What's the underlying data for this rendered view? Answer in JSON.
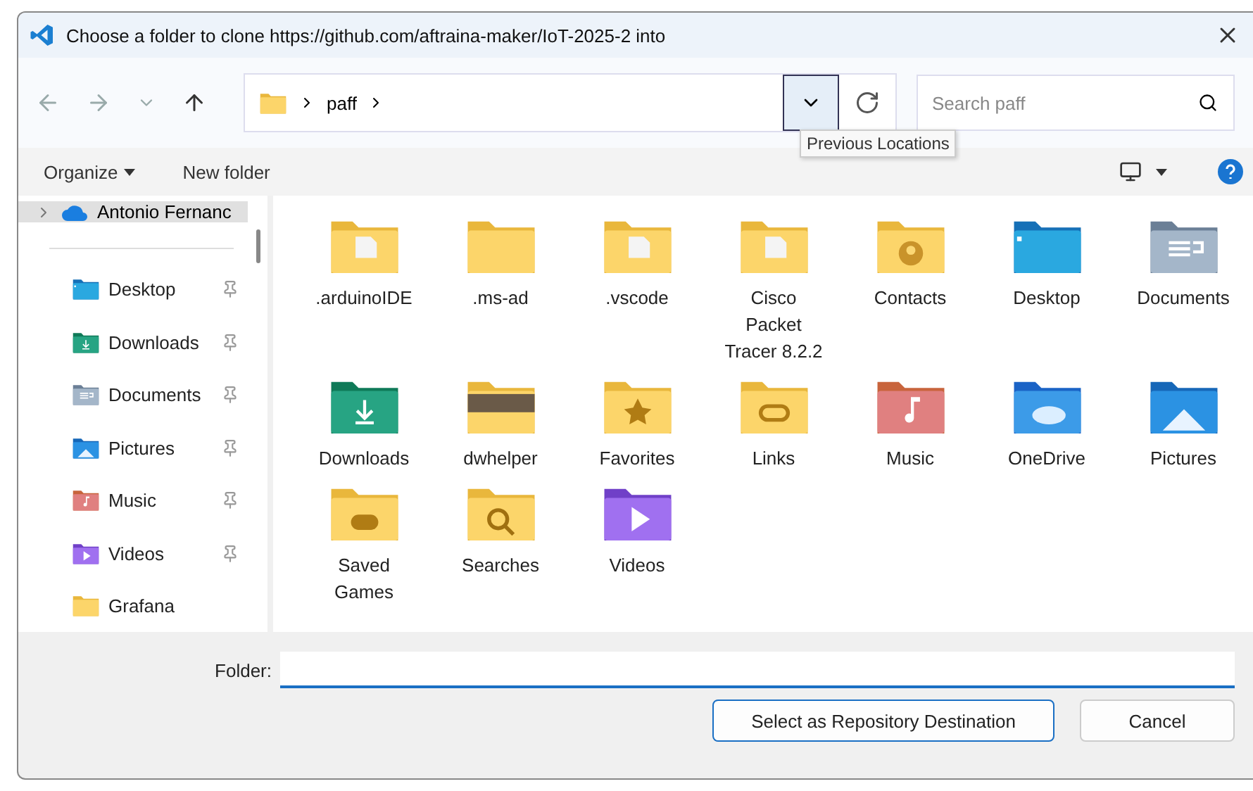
{
  "window": {
    "title": "Choose a folder to clone https://github.com/aftraina-maker/IoT-2025-2 into"
  },
  "address": {
    "segments": [
      "paff"
    ]
  },
  "recent_dropdown": {
    "tooltip": "Previous Locations"
  },
  "search": {
    "placeholder": "Search paff"
  },
  "commands": {
    "organize": "Organize",
    "new_folder": "New folder"
  },
  "sidebar": {
    "root": {
      "label": "Antonio Fernanc",
      "selected": true
    },
    "items": [
      {
        "label": "Desktop",
        "kind": "desktop",
        "pinned": true
      },
      {
        "label": "Downloads",
        "kind": "downloads",
        "pinned": true
      },
      {
        "label": "Documents",
        "kind": "documents",
        "pinned": true
      },
      {
        "label": "Pictures",
        "kind": "pictures",
        "pinned": true
      },
      {
        "label": "Music",
        "kind": "music",
        "pinned": true
      },
      {
        "label": "Videos",
        "kind": "videos",
        "pinned": true
      },
      {
        "label": "Grafana",
        "kind": "folder",
        "pinned": false
      }
    ]
  },
  "files": [
    {
      "name": ".arduinoIDE",
      "kind": "document"
    },
    {
      "name": ".ms-ad",
      "kind": "plain"
    },
    {
      "name": ".vscode",
      "kind": "document"
    },
    {
      "name": "Cisco Packet Tracer 8.2.2",
      "kind": "document"
    },
    {
      "name": "Contacts",
      "kind": "contacts"
    },
    {
      "name": "Desktop",
      "kind": "desktop"
    },
    {
      "name": "Documents",
      "kind": "documents"
    },
    {
      "name": "Downloads",
      "kind": "downloads"
    },
    {
      "name": "dwhelper",
      "kind": "photo"
    },
    {
      "name": "Favorites",
      "kind": "favorites"
    },
    {
      "name": "Links",
      "kind": "links"
    },
    {
      "name": "Music",
      "kind": "music"
    },
    {
      "name": "OneDrive",
      "kind": "onedrive"
    },
    {
      "name": "Pictures",
      "kind": "pictures"
    },
    {
      "name": "Saved Games",
      "kind": "games"
    },
    {
      "name": "Searches",
      "kind": "searches"
    },
    {
      "name": "Videos",
      "kind": "videos"
    }
  ],
  "folder_field": {
    "label": "Folder:"
  },
  "buttons": {
    "primary": "Select as Repository Destination",
    "cancel": "Cancel"
  }
}
